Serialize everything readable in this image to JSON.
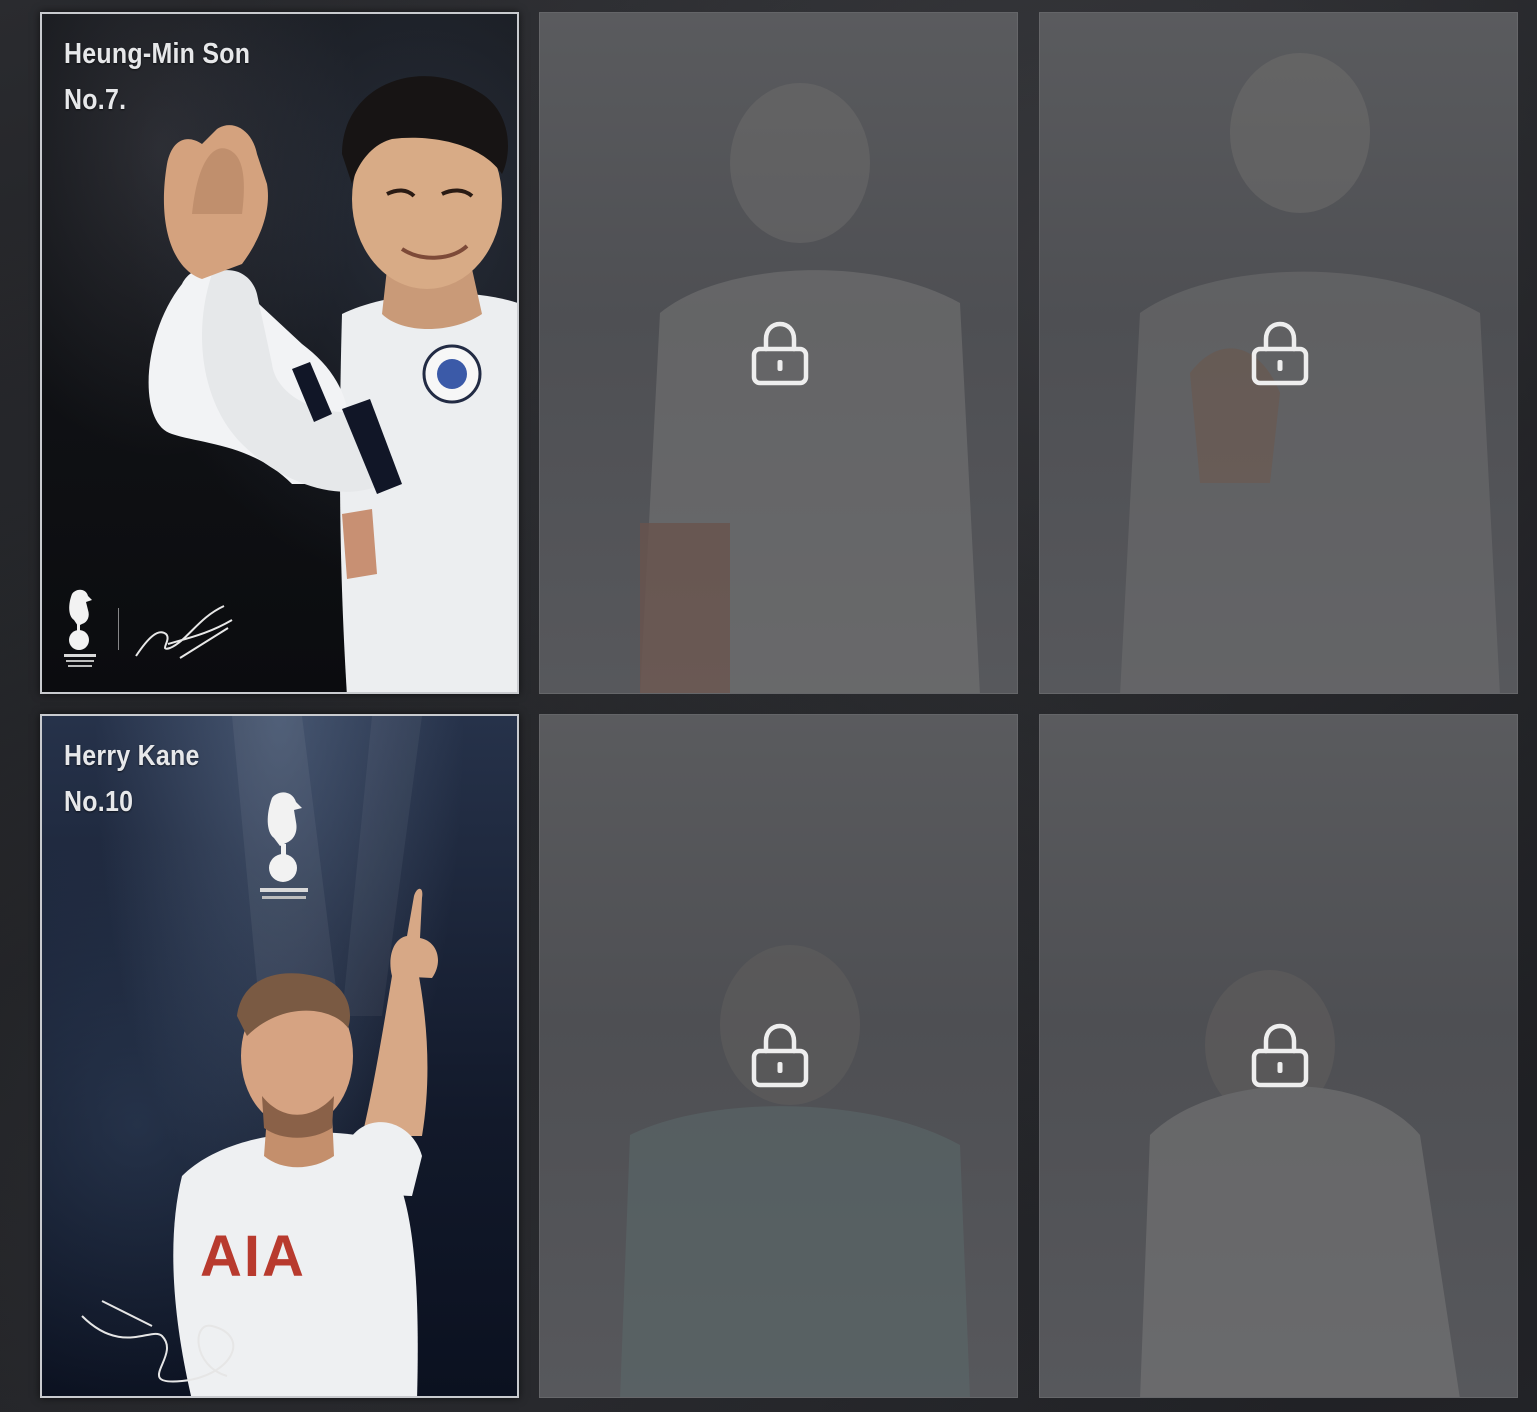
{
  "cards": [
    {
      "name": "Heung-Min Son",
      "number": "No.7.",
      "status": "unlocked"
    },
    {
      "status": "locked",
      "icon": "lock-icon"
    },
    {
      "status": "locked",
      "icon": "lock-icon"
    },
    {
      "name": "Herry Kane",
      "number": "No.10",
      "status": "unlocked"
    },
    {
      "status": "locked",
      "icon": "lock-icon"
    },
    {
      "status": "locked",
      "icon": "lock-icon"
    }
  ]
}
